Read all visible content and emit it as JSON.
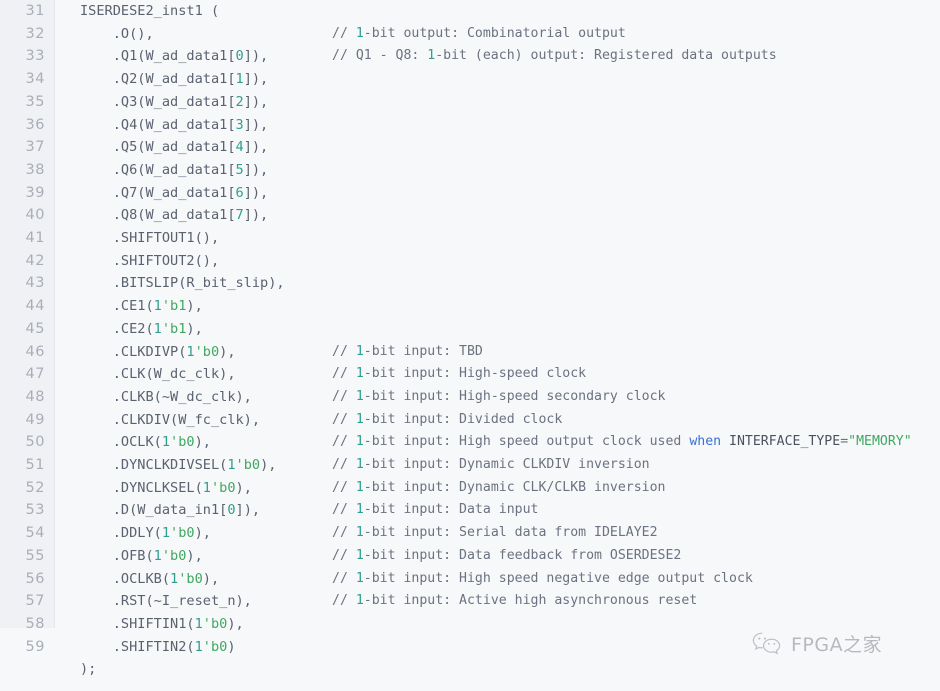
{
  "editor": {
    "language": "verilog",
    "background_color": "#f7f8fa",
    "gutter_color": "#f0f1f4",
    "code_color": "#5a6270",
    "comment_color": "#6b7280",
    "number_color": "#2f9e8f",
    "literal_color": "#3fa860",
    "keyword_color": "#3b6fd4",
    "line_number_color": "#a9aeb8",
    "first_line_number": 31,
    "last_numbered_line": 59
  },
  "lines": [
    {
      "number": "31",
      "code_tokens": [
        {
          "t": "ISERDESE2_inst1 (",
          "c": "plain"
        }
      ],
      "comment_tokens": []
    },
    {
      "number": "32",
      "code_tokens": [
        {
          "t": "    .O(),",
          "c": "plain"
        }
      ],
      "comment_tokens": [
        {
          "t": "// ",
          "c": "plain"
        },
        {
          "t": "1",
          "c": "num"
        },
        {
          "t": "-bit output: Combinatorial output",
          "c": "plain"
        }
      ]
    },
    {
      "number": "33",
      "code_tokens": [
        {
          "t": "    .Q1(W_ad_data1[",
          "c": "plain"
        },
        {
          "t": "0",
          "c": "num"
        },
        {
          "t": "]),",
          "c": "plain"
        }
      ],
      "comment_tokens": [
        {
          "t": "// Q1 - Q8: ",
          "c": "plain"
        },
        {
          "t": "1",
          "c": "num"
        },
        {
          "t": "-bit (each) output: Registered data outputs",
          "c": "plain"
        }
      ]
    },
    {
      "number": "34",
      "code_tokens": [
        {
          "t": "    .Q2(W_ad_data1[",
          "c": "plain"
        },
        {
          "t": "1",
          "c": "num"
        },
        {
          "t": "]),",
          "c": "plain"
        }
      ],
      "comment_tokens": []
    },
    {
      "number": "35",
      "code_tokens": [
        {
          "t": "    .Q3(W_ad_data1[",
          "c": "plain"
        },
        {
          "t": "2",
          "c": "num"
        },
        {
          "t": "]),",
          "c": "plain"
        }
      ],
      "comment_tokens": []
    },
    {
      "number": "36",
      "code_tokens": [
        {
          "t": "    .Q4(W_ad_data1[",
          "c": "plain"
        },
        {
          "t": "3",
          "c": "num"
        },
        {
          "t": "]),",
          "c": "plain"
        }
      ],
      "comment_tokens": []
    },
    {
      "number": "37",
      "code_tokens": [
        {
          "t": "    .Q5(W_ad_data1[",
          "c": "plain"
        },
        {
          "t": "4",
          "c": "num"
        },
        {
          "t": "]),",
          "c": "plain"
        }
      ],
      "comment_tokens": []
    },
    {
      "number": "38",
      "code_tokens": [
        {
          "t": "    .Q6(W_ad_data1[",
          "c": "plain"
        },
        {
          "t": "5",
          "c": "num"
        },
        {
          "t": "]),",
          "c": "plain"
        }
      ],
      "comment_tokens": []
    },
    {
      "number": "39",
      "code_tokens": [
        {
          "t": "    .Q7(W_ad_data1[",
          "c": "plain"
        },
        {
          "t": "6",
          "c": "num"
        },
        {
          "t": "]),",
          "c": "plain"
        }
      ],
      "comment_tokens": []
    },
    {
      "number": "40",
      "code_tokens": [
        {
          "t": "    .Q8(W_ad_data1[",
          "c": "plain"
        },
        {
          "t": "7",
          "c": "num"
        },
        {
          "t": "]),",
          "c": "plain"
        }
      ],
      "comment_tokens": []
    },
    {
      "number": "41",
      "code_tokens": [
        {
          "t": "    .SHIFTOUT1(),",
          "c": "plain"
        }
      ],
      "comment_tokens": []
    },
    {
      "number": "42",
      "code_tokens": [
        {
          "t": "    .SHIFTOUT2(),",
          "c": "plain"
        }
      ],
      "comment_tokens": []
    },
    {
      "number": "43",
      "code_tokens": [
        {
          "t": "    .BITSLIP(R_bit_slip),",
          "c": "plain"
        }
      ],
      "comment_tokens": []
    },
    {
      "number": "44",
      "code_tokens": [
        {
          "t": "    .CE1(",
          "c": "plain"
        },
        {
          "t": "1",
          "c": "num"
        },
        {
          "t": "'b1",
          "c": "lit"
        },
        {
          "t": "),",
          "c": "plain"
        }
      ],
      "comment_tokens": []
    },
    {
      "number": "45",
      "code_tokens": [
        {
          "t": "    .CE2(",
          "c": "plain"
        },
        {
          "t": "1",
          "c": "num"
        },
        {
          "t": "'b1",
          "c": "lit"
        },
        {
          "t": "),",
          "c": "plain"
        }
      ],
      "comment_tokens": []
    },
    {
      "number": "46",
      "code_tokens": [
        {
          "t": "    .CLKDIVP(",
          "c": "plain"
        },
        {
          "t": "1",
          "c": "num"
        },
        {
          "t": "'b0",
          "c": "lit"
        },
        {
          "t": "),",
          "c": "plain"
        }
      ],
      "comment_tokens": [
        {
          "t": "// ",
          "c": "plain"
        },
        {
          "t": "1",
          "c": "num"
        },
        {
          "t": "-bit input: TBD",
          "c": "plain"
        }
      ]
    },
    {
      "number": "47",
      "code_tokens": [
        {
          "t": "    .CLK(W_dc_clk),",
          "c": "plain"
        }
      ],
      "comment_tokens": [
        {
          "t": "// ",
          "c": "plain"
        },
        {
          "t": "1",
          "c": "num"
        },
        {
          "t": "-bit input: High-speed clock",
          "c": "plain"
        }
      ]
    },
    {
      "number": "48",
      "code_tokens": [
        {
          "t": "    .CLKB(~W_dc_clk),",
          "c": "plain"
        }
      ],
      "comment_tokens": [
        {
          "t": "// ",
          "c": "plain"
        },
        {
          "t": "1",
          "c": "num"
        },
        {
          "t": "-bit input: High-speed secondary clock",
          "c": "plain"
        }
      ]
    },
    {
      "number": "49",
      "code_tokens": [
        {
          "t": "    .CLKDIV(W_fc_clk),",
          "c": "plain"
        }
      ],
      "comment_tokens": [
        {
          "t": "// ",
          "c": "plain"
        },
        {
          "t": "1",
          "c": "num"
        },
        {
          "t": "-bit input: Divided clock",
          "c": "plain"
        }
      ]
    },
    {
      "number": "50",
      "code_tokens": [
        {
          "t": "    .OCLK(",
          "c": "plain"
        },
        {
          "t": "1",
          "c": "num"
        },
        {
          "t": "'b0",
          "c": "lit"
        },
        {
          "t": "),",
          "c": "plain"
        }
      ],
      "comment_tokens": [
        {
          "t": "// ",
          "c": "plain"
        },
        {
          "t": "1",
          "c": "num"
        },
        {
          "t": "-bit input: High speed output clock used ",
          "c": "plain"
        },
        {
          "t": "when",
          "c": "kw"
        },
        {
          "t": " ",
          "c": "plain"
        },
        {
          "t": "INTERFACE_TYPE",
          "c": "ident"
        },
        {
          "t": "=",
          "c": "plain"
        },
        {
          "t": "\"MEMORY\"",
          "c": "str"
        }
      ]
    },
    {
      "number": "51",
      "code_tokens": [
        {
          "t": "    .DYNCLKDIVSEL(",
          "c": "plain"
        },
        {
          "t": "1",
          "c": "num"
        },
        {
          "t": "'b0",
          "c": "lit"
        },
        {
          "t": "),",
          "c": "plain"
        }
      ],
      "comment_tokens": [
        {
          "t": "// ",
          "c": "plain"
        },
        {
          "t": "1",
          "c": "num"
        },
        {
          "t": "-bit input: Dynamic CLKDIV inversion",
          "c": "plain"
        }
      ]
    },
    {
      "number": "52",
      "code_tokens": [
        {
          "t": "    .DYNCLKSEL(",
          "c": "plain"
        },
        {
          "t": "1",
          "c": "num"
        },
        {
          "t": "'b0",
          "c": "lit"
        },
        {
          "t": "),",
          "c": "plain"
        }
      ],
      "comment_tokens": [
        {
          "t": "// ",
          "c": "plain"
        },
        {
          "t": "1",
          "c": "num"
        },
        {
          "t": "-bit input: Dynamic CLK/CLKB inversion",
          "c": "plain"
        }
      ]
    },
    {
      "number": "53",
      "code_tokens": [
        {
          "t": "    .D(W_data_in1[",
          "c": "plain"
        },
        {
          "t": "0",
          "c": "num"
        },
        {
          "t": "]),",
          "c": "plain"
        }
      ],
      "comment_tokens": [
        {
          "t": "// ",
          "c": "plain"
        },
        {
          "t": "1",
          "c": "num"
        },
        {
          "t": "-bit input: Data input",
          "c": "plain"
        }
      ]
    },
    {
      "number": "54",
      "code_tokens": [
        {
          "t": "    .DDLY(",
          "c": "plain"
        },
        {
          "t": "1",
          "c": "num"
        },
        {
          "t": "'b0",
          "c": "lit"
        },
        {
          "t": "),",
          "c": "plain"
        }
      ],
      "comment_tokens": [
        {
          "t": "// ",
          "c": "plain"
        },
        {
          "t": "1",
          "c": "num"
        },
        {
          "t": "-bit input: Serial data from IDELAYE2",
          "c": "plain"
        }
      ]
    },
    {
      "number": "55",
      "code_tokens": [
        {
          "t": "    .OFB(",
          "c": "plain"
        },
        {
          "t": "1",
          "c": "num"
        },
        {
          "t": "'b0",
          "c": "lit"
        },
        {
          "t": "),",
          "c": "plain"
        }
      ],
      "comment_tokens": [
        {
          "t": "// ",
          "c": "plain"
        },
        {
          "t": "1",
          "c": "num"
        },
        {
          "t": "-bit input: Data feedback from OSERDESE2",
          "c": "plain"
        }
      ]
    },
    {
      "number": "56",
      "code_tokens": [
        {
          "t": "    .OCLKB(",
          "c": "plain"
        },
        {
          "t": "1",
          "c": "num"
        },
        {
          "t": "'b0",
          "c": "lit"
        },
        {
          "t": "),",
          "c": "plain"
        }
      ],
      "comment_tokens": [
        {
          "t": "// ",
          "c": "plain"
        },
        {
          "t": "1",
          "c": "num"
        },
        {
          "t": "-bit input: High speed negative edge output clock",
          "c": "plain"
        }
      ]
    },
    {
      "number": "57",
      "code_tokens": [
        {
          "t": "    .RST(~I_reset_n),",
          "c": "plain"
        }
      ],
      "comment_tokens": [
        {
          "t": "// ",
          "c": "plain"
        },
        {
          "t": "1",
          "c": "num"
        },
        {
          "t": "-bit input: Active high asynchronous reset",
          "c": "plain"
        }
      ]
    },
    {
      "number": "58",
      "code_tokens": [
        {
          "t": "    .SHIFTIN1(",
          "c": "plain"
        },
        {
          "t": "1",
          "c": "num"
        },
        {
          "t": "'b0",
          "c": "lit"
        },
        {
          "t": "),",
          "c": "plain"
        }
      ],
      "comment_tokens": []
    },
    {
      "number": "59",
      "code_tokens": [
        {
          "t": "    .SHIFTIN2(",
          "c": "plain"
        },
        {
          "t": "1",
          "c": "num"
        },
        {
          "t": "'b0",
          "c": "lit"
        },
        {
          "t": ")",
          "c": "plain"
        }
      ],
      "comment_tokens": []
    },
    {
      "number": "",
      "code_tokens": [
        {
          "t": ");",
          "c": "plain"
        }
      ],
      "comment_tokens": []
    }
  ],
  "watermark": {
    "icon": "wechat-logo-icon",
    "text": "FPGA之家"
  }
}
